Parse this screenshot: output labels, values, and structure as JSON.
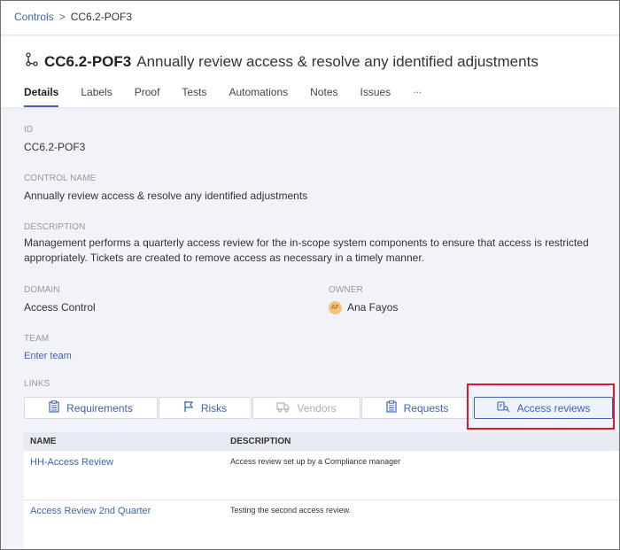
{
  "breadcrumb": {
    "parent": "Controls",
    "separator": ">",
    "current": "CC6.2-POF3"
  },
  "title": {
    "id": "CC6.2-POF3",
    "text": "Annually review access & resolve any identified adjustments"
  },
  "tabs": [
    {
      "label": "Details",
      "active": true
    },
    {
      "label": "Labels"
    },
    {
      "label": "Proof"
    },
    {
      "label": "Tests"
    },
    {
      "label": "Automations"
    },
    {
      "label": "Notes"
    },
    {
      "label": "Issues"
    },
    {
      "label": "..."
    }
  ],
  "fields": {
    "id": {
      "label": "ID",
      "value": "CC6.2-POF3"
    },
    "control_name": {
      "label": "CONTROL NAME",
      "value": "Annually review access & resolve any identified adjustments"
    },
    "description": {
      "label": "DESCRIPTION",
      "line1": "Management performs a quarterly access review for the in-scope system components to ensure that access is restricted",
      "line2": "appropriately. Tickets are created to remove access as necessary in a timely manner."
    },
    "domain": {
      "label": "DOMAIN",
      "value": "Access Control"
    },
    "owner": {
      "label": "OWNER",
      "initials": "AF",
      "value": "Ana Fayos"
    },
    "team": {
      "label": "TEAM",
      "value": "Enter team"
    },
    "links": {
      "label": "LINKS"
    }
  },
  "link_buttons": [
    {
      "label": "Requirements",
      "icon": "clipboard-icon"
    },
    {
      "label": "Risks",
      "icon": "flag-icon"
    },
    {
      "label": "Vendors",
      "icon": "truck-icon",
      "disabled": true
    },
    {
      "label": "Requests",
      "icon": "clipboard-icon"
    },
    {
      "label": "Access reviews",
      "icon": "key-icon",
      "active": true
    }
  ],
  "table": {
    "headers": {
      "name": "NAME",
      "description": "DESCRIPTION"
    },
    "rows": [
      {
        "name": "HH-Access Review",
        "description": "Access review set up by a Compliance manager"
      },
      {
        "name": "Access Review 2nd Quarter",
        "description": "Testing the second access review."
      }
    ]
  },
  "colors": {
    "accent": "#3d63b0",
    "highlight": "#d7192a",
    "background": "#f2f3f8"
  }
}
